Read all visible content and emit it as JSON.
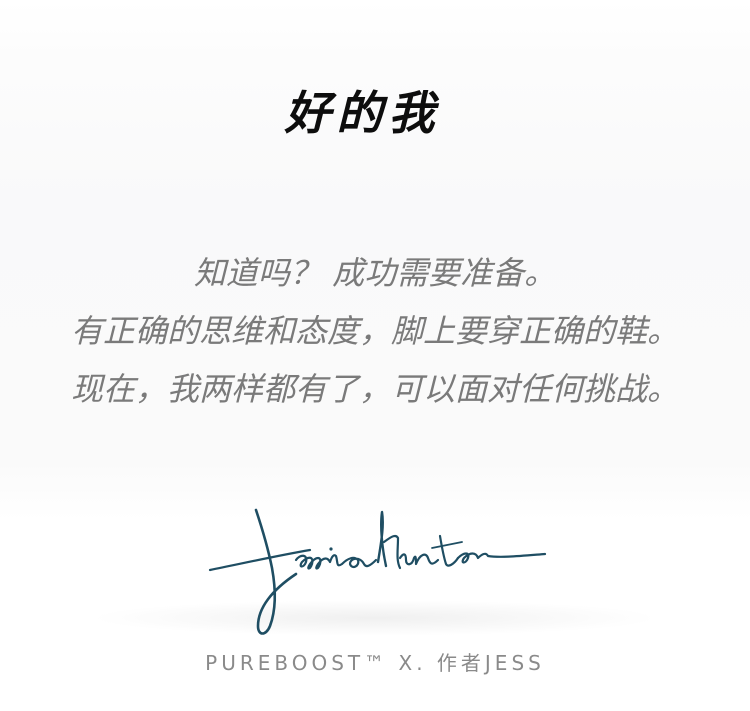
{
  "title": "好的我",
  "body": {
    "lines": [
      "知道吗？ 成功需要准备。",
      "有正确的思维和态度，脚上要穿正确的鞋。",
      "现在，我两样都有了，可以面对任何挑战。"
    ]
  },
  "signature": {
    "text": "Jessica Hunter"
  },
  "footer": {
    "text": "PUREBOOST™ X. 作者JESS"
  },
  "colors": {
    "title": "#0d0d0d",
    "body": "#7a7a7a",
    "signature_ink": "#1f4e63",
    "footer": "#8a8a8a"
  }
}
